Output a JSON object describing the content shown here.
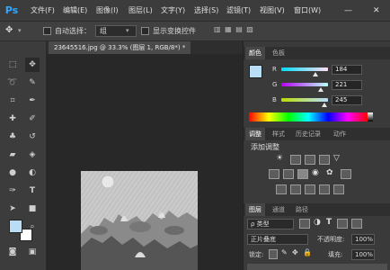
{
  "app": {
    "logo": "Ps"
  },
  "menu": [
    "文件(F)",
    "编辑(E)",
    "图像(I)",
    "图层(L)",
    "文字(Y)",
    "选择(S)",
    "滤镜(T)",
    "视图(V)",
    "窗口(W)"
  ],
  "window_controls": {
    "minimize": "—",
    "close": "✕"
  },
  "options_bar": {
    "auto_select_label": "自动选择：",
    "auto_select_value": "组",
    "show_transform_label": "显示变换控件"
  },
  "document": {
    "tab_title": "23645516.jpg @ 33.3% (图层 1, RGB/8*) *"
  },
  "color_panel": {
    "tabs": [
      "颜色",
      "色板"
    ],
    "swatch_color": "#b8ddf5",
    "channels": [
      {
        "label": "R",
        "value": "184"
      },
      {
        "label": "G",
        "value": "221"
      },
      {
        "label": "B",
        "value": "245"
      }
    ]
  },
  "adjust_panel": {
    "tabs": [
      "调整",
      "样式",
      "历史记录",
      "动作"
    ],
    "title": "添加调整"
  },
  "layers_panel": {
    "tabs": [
      "图层",
      "通道",
      "路径"
    ],
    "kind_label": "ρ 类型",
    "blend_mode": "正片叠底",
    "opacity_label": "不透明度:",
    "opacity_value": "100%",
    "lock_label": "锁定:",
    "fill_label": "填充:",
    "fill_value": "100%"
  },
  "colors": {
    "foreground": "#b8ddf5",
    "background": "#ffffff"
  }
}
